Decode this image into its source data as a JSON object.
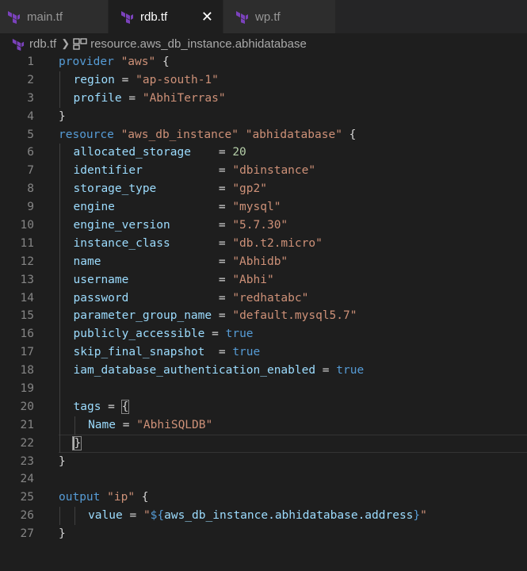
{
  "tabs": [
    {
      "label": "main.tf",
      "active": false
    },
    {
      "label": "rdb.tf",
      "active": true
    },
    {
      "label": "wp.tf",
      "active": false
    }
  ],
  "breadcrumb": {
    "file": "rdb.tf",
    "symbol": "resource.aws_db_instance.abhidatabase"
  },
  "colors": {
    "keyword": "#569cd6",
    "string": "#ce9178",
    "number": "#b5cea8",
    "identifier": "#9cdcfe",
    "terraform_icon": "#7b42bc"
  },
  "lines": [
    {
      "n": "1",
      "indent": 0,
      "tokens": [
        [
          "kw",
          "provider"
        ],
        [
          "op",
          " "
        ],
        [
          "str",
          "\"aws\""
        ],
        [
          "op",
          " {"
        ]
      ]
    },
    {
      "n": "2",
      "indent": 1,
      "tokens": [
        [
          "id",
          "region"
        ],
        [
          "op",
          " = "
        ],
        [
          "str",
          "\"ap-south-1\""
        ]
      ]
    },
    {
      "n": "3",
      "indent": 1,
      "tokens": [
        [
          "id",
          "profile"
        ],
        [
          "op",
          " = "
        ],
        [
          "str",
          "\"AbhiTerras\""
        ]
      ]
    },
    {
      "n": "4",
      "indent": 0,
      "tokens": [
        [
          "op",
          "}"
        ]
      ]
    },
    {
      "n": "5",
      "indent": 0,
      "tokens": [
        [
          "kw",
          "resource"
        ],
        [
          "op",
          " "
        ],
        [
          "str",
          "\"aws_db_instance\""
        ],
        [
          "op",
          " "
        ],
        [
          "str",
          "\"abhidatabase\""
        ],
        [
          "op",
          " {"
        ]
      ]
    },
    {
      "n": "6",
      "indent": 1,
      "tokens": [
        [
          "id",
          "allocated_storage"
        ],
        [
          "op",
          "    = "
        ],
        [
          "num",
          "20"
        ]
      ]
    },
    {
      "n": "7",
      "indent": 1,
      "tokens": [
        [
          "id",
          "identifier"
        ],
        [
          "op",
          "           = "
        ],
        [
          "str",
          "\"dbinstance\""
        ]
      ]
    },
    {
      "n": "8",
      "indent": 1,
      "tokens": [
        [
          "id",
          "storage_type"
        ],
        [
          "op",
          "         = "
        ],
        [
          "str",
          "\"gp2\""
        ]
      ]
    },
    {
      "n": "9",
      "indent": 1,
      "tokens": [
        [
          "id",
          "engine"
        ],
        [
          "op",
          "               = "
        ],
        [
          "str",
          "\"mysql\""
        ]
      ]
    },
    {
      "n": "10",
      "indent": 1,
      "tokens": [
        [
          "id",
          "engine_version"
        ],
        [
          "op",
          "       = "
        ],
        [
          "str",
          "\"5.7.30\""
        ]
      ]
    },
    {
      "n": "11",
      "indent": 1,
      "tokens": [
        [
          "id",
          "instance_class"
        ],
        [
          "op",
          "       = "
        ],
        [
          "str",
          "\"db.t2.micro\""
        ]
      ]
    },
    {
      "n": "12",
      "indent": 1,
      "tokens": [
        [
          "id",
          "name"
        ],
        [
          "op",
          "                 = "
        ],
        [
          "str",
          "\"Abhidb\""
        ]
      ]
    },
    {
      "n": "13",
      "indent": 1,
      "tokens": [
        [
          "id",
          "username"
        ],
        [
          "op",
          "             = "
        ],
        [
          "str",
          "\"Abhi\""
        ]
      ]
    },
    {
      "n": "14",
      "indent": 1,
      "tokens": [
        [
          "id",
          "password"
        ],
        [
          "op",
          "             = "
        ],
        [
          "str",
          "\"redhatabc\""
        ]
      ]
    },
    {
      "n": "15",
      "indent": 1,
      "tokens": [
        [
          "id",
          "parameter_group_name"
        ],
        [
          "op",
          " = "
        ],
        [
          "str",
          "\"default.mysql5.7\""
        ]
      ]
    },
    {
      "n": "16",
      "indent": 1,
      "tokens": [
        [
          "id",
          "publicly_accessible"
        ],
        [
          "op",
          " = "
        ],
        [
          "kw",
          "true"
        ]
      ]
    },
    {
      "n": "17",
      "indent": 1,
      "tokens": [
        [
          "id",
          "skip_final_snapshot"
        ],
        [
          "op",
          "  = "
        ],
        [
          "kw",
          "true"
        ]
      ]
    },
    {
      "n": "18",
      "indent": 1,
      "tokens": [
        [
          "id",
          "iam_database_authentication_enabled"
        ],
        [
          "op",
          " = "
        ],
        [
          "kw",
          "true"
        ]
      ]
    },
    {
      "n": "19",
      "indent": 1,
      "tokens": []
    },
    {
      "n": "20",
      "indent": 1,
      "tokens": [
        [
          "id",
          "tags"
        ],
        [
          "op",
          " = "
        ],
        [
          "bracket",
          "{"
        ]
      ]
    },
    {
      "n": "21",
      "indent": 2,
      "tokens": [
        [
          "id",
          "Name"
        ],
        [
          "op",
          " = "
        ],
        [
          "str",
          "\"AbhiSQLDB\""
        ]
      ]
    },
    {
      "n": "22",
      "indent": 1,
      "tokens": [
        [
          "bracketcaret",
          "}"
        ]
      ],
      "current": true
    },
    {
      "n": "23",
      "indent": 0,
      "tokens": [
        [
          "op",
          "}"
        ]
      ]
    },
    {
      "n": "24",
      "indent": 0,
      "tokens": []
    },
    {
      "n": "25",
      "indent": 0,
      "tokens": [
        [
          "kw",
          "output"
        ],
        [
          "op",
          " "
        ],
        [
          "str",
          "\"ip\""
        ],
        [
          "op",
          " {"
        ]
      ]
    },
    {
      "n": "26",
      "indent": 2,
      "tokens": [
        [
          "id",
          "value"
        ],
        [
          "op",
          " = "
        ],
        [
          "str",
          "\""
        ],
        [
          "interp",
          "${"
        ],
        [
          "id",
          "aws_db_instance.abhidatabase.address"
        ],
        [
          "interp",
          "}"
        ],
        [
          "str",
          "\""
        ]
      ]
    },
    {
      "n": "27",
      "indent": 0,
      "tokens": [
        [
          "op",
          "}"
        ]
      ]
    }
  ]
}
